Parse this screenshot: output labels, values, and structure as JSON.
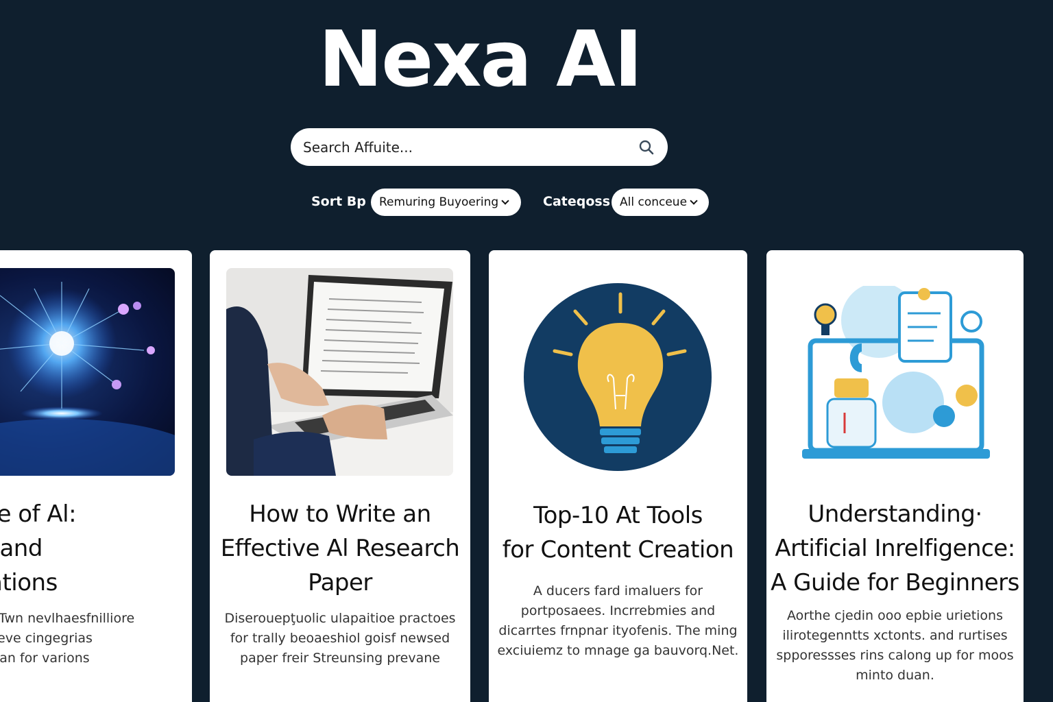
{
  "app": {
    "title": "Nexa AI"
  },
  "search": {
    "placeholder": "Search Affuite..."
  },
  "filters": {
    "sort_label": "Sort Bp",
    "sort_value": "Remuring Buyoering",
    "category_label": "Cateqoss",
    "category_value": "All conceue"
  },
  "cards": [
    {
      "title_lines": [
        "e Future of Al:",
        "Trerids and",
        "dhnovations"
      ],
      "desc_lines": [
        "Twn nevlhaesfnilliore",
        "er dias or itreve cingegrias",
        "guational upan for varions"
      ],
      "image": "neural-network-globe"
    },
    {
      "title_lines": [
        "How to Write an",
        "Effective Al Research",
        "Paper"
      ],
      "desc_lines": [
        "Diserouepţuolic ulapaitioe practoes",
        "for trally beoaeshiol goisf newsed",
        "paper freir Streunsing prevane"
      ],
      "image": "person-typing-laptop"
    },
    {
      "title_lines": [
        "Top-10 At Tools",
        "for Content Creation"
      ],
      "desc_lines": [
        "A ducers fard imaluers for",
        "portposaees. Incrrebmies and",
        "dicarrtes frnpnar ityofenis. The ming",
        "exciuiemz to mnage ga bauvorq.Net."
      ],
      "image": "lightbulb"
    },
    {
      "title_lines": [
        "Understanding·",
        "Artificial Inrelfigence:",
        "A Guide for Beginners"
      ],
      "desc_lines": [
        "Aorthe cjedin ooo epbie urietions",
        "ilirotegenntts xctonts. and rurtises",
        "spporessses rins calong up for moos",
        "minto duan."
      ],
      "image": "ai-laptop-illustration"
    }
  ],
  "colors": {
    "background": "#0f1f2e",
    "card": "#ffffff",
    "accent_blue": "#2d9bd6",
    "bulb_circle": "#123c63",
    "bulb_yellow": "#f0c04a"
  }
}
